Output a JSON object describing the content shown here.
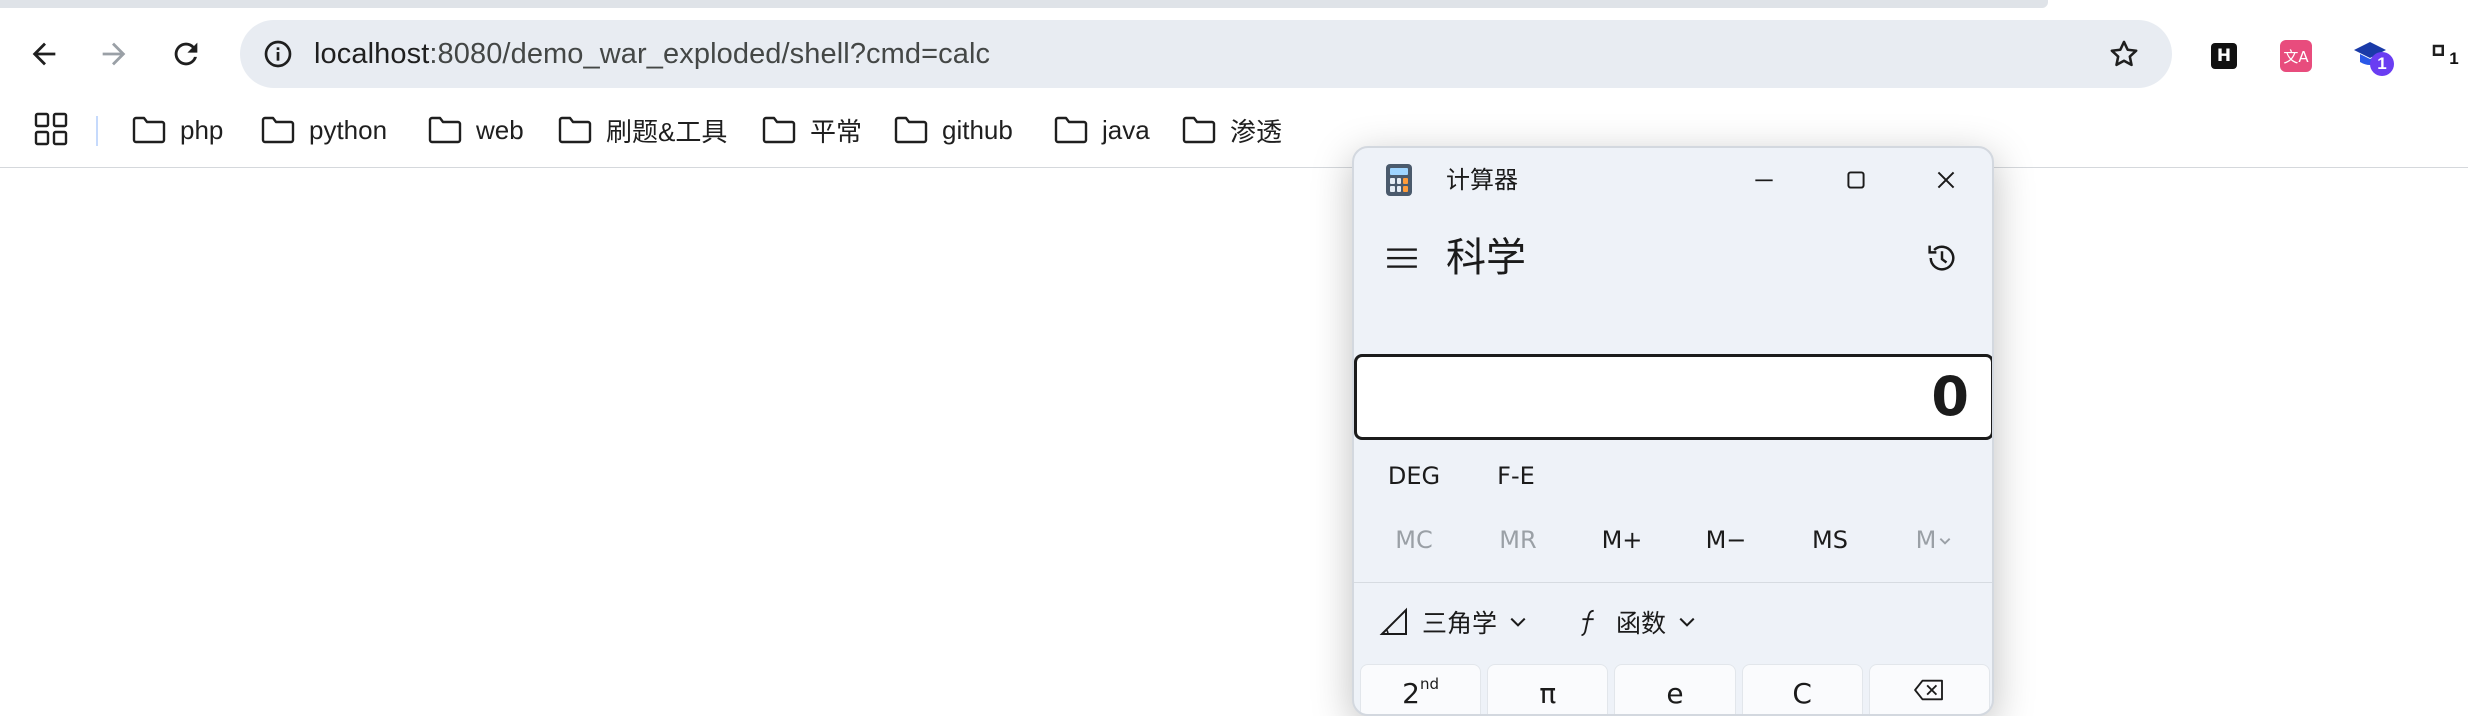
{
  "browser": {
    "omnibox": {
      "host": "localhost",
      "rest": ":8080/demo_war_exploded/shell?cmd=calc"
    },
    "extensions": {
      "h_label": "H",
      "translate_label": "文A",
      "grad_badge": "1",
      "last_badge": "1"
    },
    "bookmarks": [
      {
        "label": "php"
      },
      {
        "label": "python"
      },
      {
        "label": "web"
      },
      {
        "label": "刷题&工具"
      },
      {
        "label": "平常"
      },
      {
        "label": "github"
      },
      {
        "label": "java"
      },
      {
        "label": "渗透"
      }
    ]
  },
  "calculator": {
    "window_title": "计算器",
    "mode": "科学",
    "display_value": "0",
    "angle_unit": "DEG",
    "notation": "F-E",
    "memory": {
      "mc": "MC",
      "mr": "MR",
      "mplus": "M+",
      "mminus": "M−",
      "ms": "MS",
      "mlist": "M"
    },
    "trig_label": "三角学",
    "func_label": "函数",
    "keys": {
      "second": "2",
      "second_sup": "nd",
      "pi": "π",
      "e": "e",
      "clear": "C"
    }
  }
}
